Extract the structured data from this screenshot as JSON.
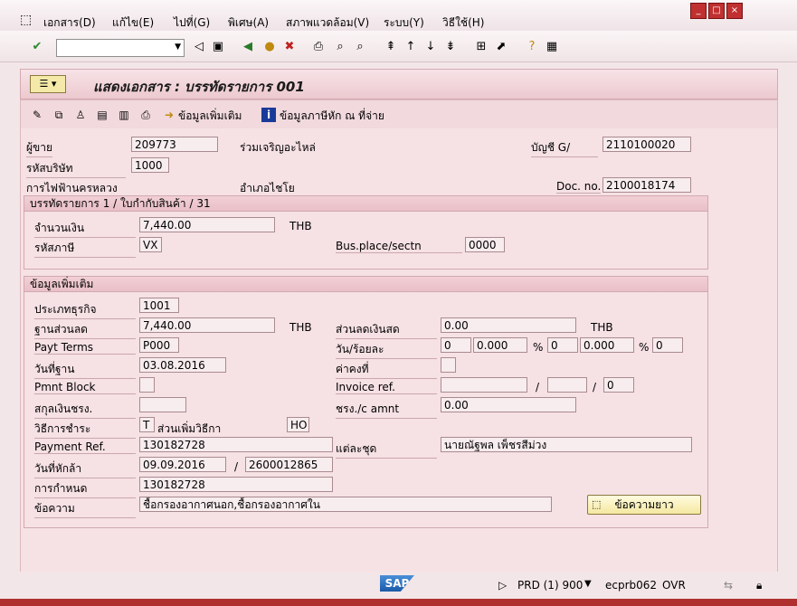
{
  "menu": [
    "เอกสาร(D)",
    "แก้ไข(E)",
    "ไปที่(G)",
    "พิเศษ(A)",
    "สภาพแวดล้อม(V)",
    "ระบบ(Y)",
    "วิธีใช้(H)"
  ],
  "page_title": "แสดงเอกสาร : บรรทัดรายการ 001",
  "appbar": {
    "more_data": "ข้อมูลเพิ่มเติม",
    "withholding": "ข้อมูลภาษีหัก ณ ที่จ่าย"
  },
  "header": {
    "vendor_label": "ผู้ขาย",
    "vendor_value": "209773",
    "vendor_name": "ร่วมเจริญอะไหล่",
    "gl_label": "บัญชี G/",
    "gl_value": "2110100020",
    "company_label": "รหัสบริษัท",
    "company_value": "1000",
    "company_name": "การไฟฟ้านครหลวง",
    "city": "อำเภอไชโย",
    "docno_label": "Doc. no.",
    "docno_value": "2100018174"
  },
  "line_group": {
    "title": "บรรทัดรายการ 1 / ใบกำกับสินค้า / 31",
    "amount_label": "จำนวนเงิน",
    "amount_value": "7,440.00",
    "currency": "THB",
    "taxcode_label": "รหัสภาษี",
    "taxcode_value": "VX",
    "busplace_label": "Bus.place/sectn",
    "busplace_value": "0000"
  },
  "more_group": {
    "title": "ข้อมูลเพิ่มเติม",
    "btype_label": "ประเภทธุรกิจ",
    "btype_value": "1001",
    "base_label": "ฐานส่วนลด",
    "base_value": "7,440.00",
    "base_cur": "THB",
    "cashdisc_label": "ส่วนลดเงินสด",
    "cashdisc_value": "0.00",
    "cashdisc_cur": "THB",
    "payterms_label": "Payt Terms",
    "payterms_value": "P000",
    "daypct_label": "วัน/ร้อยละ",
    "day1": "0",
    "pct1": "0.000",
    "pct_sym": "%",
    "day2": "0",
    "pct2": "0.000",
    "day3": "0",
    "baseline_label": "วันที่ฐาน",
    "baseline_value": "03.08.2016",
    "fixed_label": "ค่าคงที่",
    "pmntblock_label": "Pmnt Block",
    "invref_label": "Invoice ref.",
    "slash": "/",
    "invref_item": "0",
    "currency_label": "สกุลเงินชรง.",
    "amnt_label": "ชรง./c amnt",
    "amnt_value": "0.00",
    "paymethod_label": "วิธีการชำระ",
    "paymethod_value": "T",
    "paymethod_suppl": "ส่วนเพิ่มวิธีกา",
    "paymethod_suppl_value": "HO",
    "payref_label": "Payment Ref.",
    "payref_value": "130182728",
    "each_label": "แต่ละชุด",
    "each_value": "นายณัฐพล เพ็ชรสีม่วง",
    "clearing_label": "วันที่หักล้า",
    "clearing_date": "09.09.2016",
    "clearing_doc": "2600012865",
    "assign_label": "การกำหนด",
    "assign_value": "130182728",
    "text_label": "ข้อความ",
    "text_value": "ชื้อกรองอากาศนอก,ชื้อกรองอากาศใน",
    "longtext_button": "ข้อความยาว"
  },
  "status": {
    "sys": "PRD (1) 900",
    "server": "ecprb062",
    "mode": "OVR"
  }
}
